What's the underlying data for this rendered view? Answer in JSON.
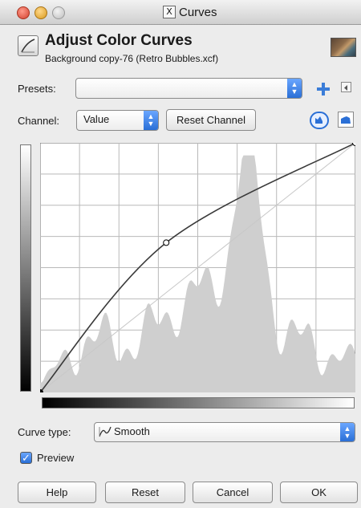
{
  "window": {
    "title": "Curves"
  },
  "header": {
    "title": "Adjust Color Curves",
    "subtitle": "Background copy-76 (Retro Bubbles.xcf)"
  },
  "presets": {
    "label": "Presets:",
    "value": ""
  },
  "channel": {
    "label": "Channel:",
    "value": "Value",
    "reset_label": "Reset Channel"
  },
  "curve_type": {
    "label": "Curve type:",
    "value": "Smooth"
  },
  "preview": {
    "label": "Preview",
    "checked": true
  },
  "buttons": {
    "help": "Help",
    "reset": "Reset",
    "cancel": "Cancel",
    "ok": "OK"
  },
  "curve": {
    "control_points": [
      [
        0,
        0
      ],
      [
        0.4,
        0.6
      ],
      [
        1,
        1
      ]
    ]
  },
  "colors": {
    "accent": "#2a6fd6",
    "histogram": "#cfcfcf"
  }
}
